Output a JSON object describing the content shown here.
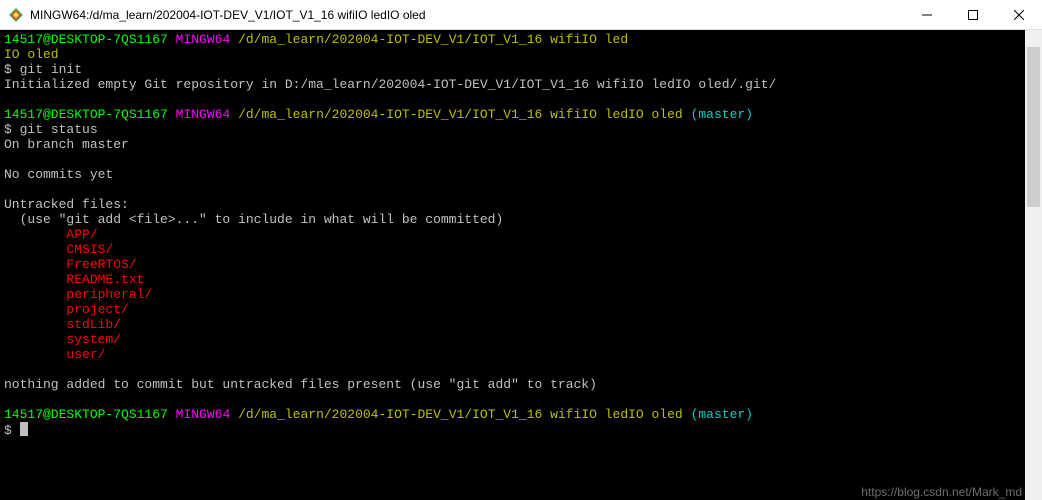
{
  "titlebar": {
    "title": "MINGW64:/d/ma_learn/202004-IOT-DEV_V1/IOT_V1_16 wifiIO ledIO oled"
  },
  "prompt": {
    "user_host": "14517@DESKTOP-7QS1167",
    "shell": "MINGW64",
    "path": "/d/ma_learn/202004-IOT-DEV_V1/IOT_V1_16 wifiIO led",
    "path_wrap": "IO oled",
    "path_full": "/d/ma_learn/202004-IOT-DEV_V1/IOT_V1_16 wifiIO ledIO oled",
    "branch": "(master)"
  },
  "cmd1": {
    "prompt": "$ ",
    "text": "git init"
  },
  "out1": "Initialized empty Git repository in D:/ma_learn/202004-IOT-DEV_V1/IOT_V1_16 wifiIO ledIO oled/.git/",
  "cmd2": {
    "prompt": "$ ",
    "text": "git status"
  },
  "status": {
    "on_branch": "On branch master",
    "no_commits": "No commits yet",
    "untracked_header": "Untracked files:",
    "untracked_hint": "  (use \"git add <file>...\" to include in what will be committed)",
    "files": [
      "APP/",
      "CMSIS/",
      "FreeRTOS/",
      "README.txt",
      "peripheral/",
      "project/",
      "stdLib/",
      "system/",
      "user/"
    ],
    "nothing_added": "nothing added to commit but untracked files present (use \"git add\" to track)"
  },
  "cmd3": {
    "prompt": "$ "
  },
  "watermark": "https://blog.csdn.net/Mark_md"
}
